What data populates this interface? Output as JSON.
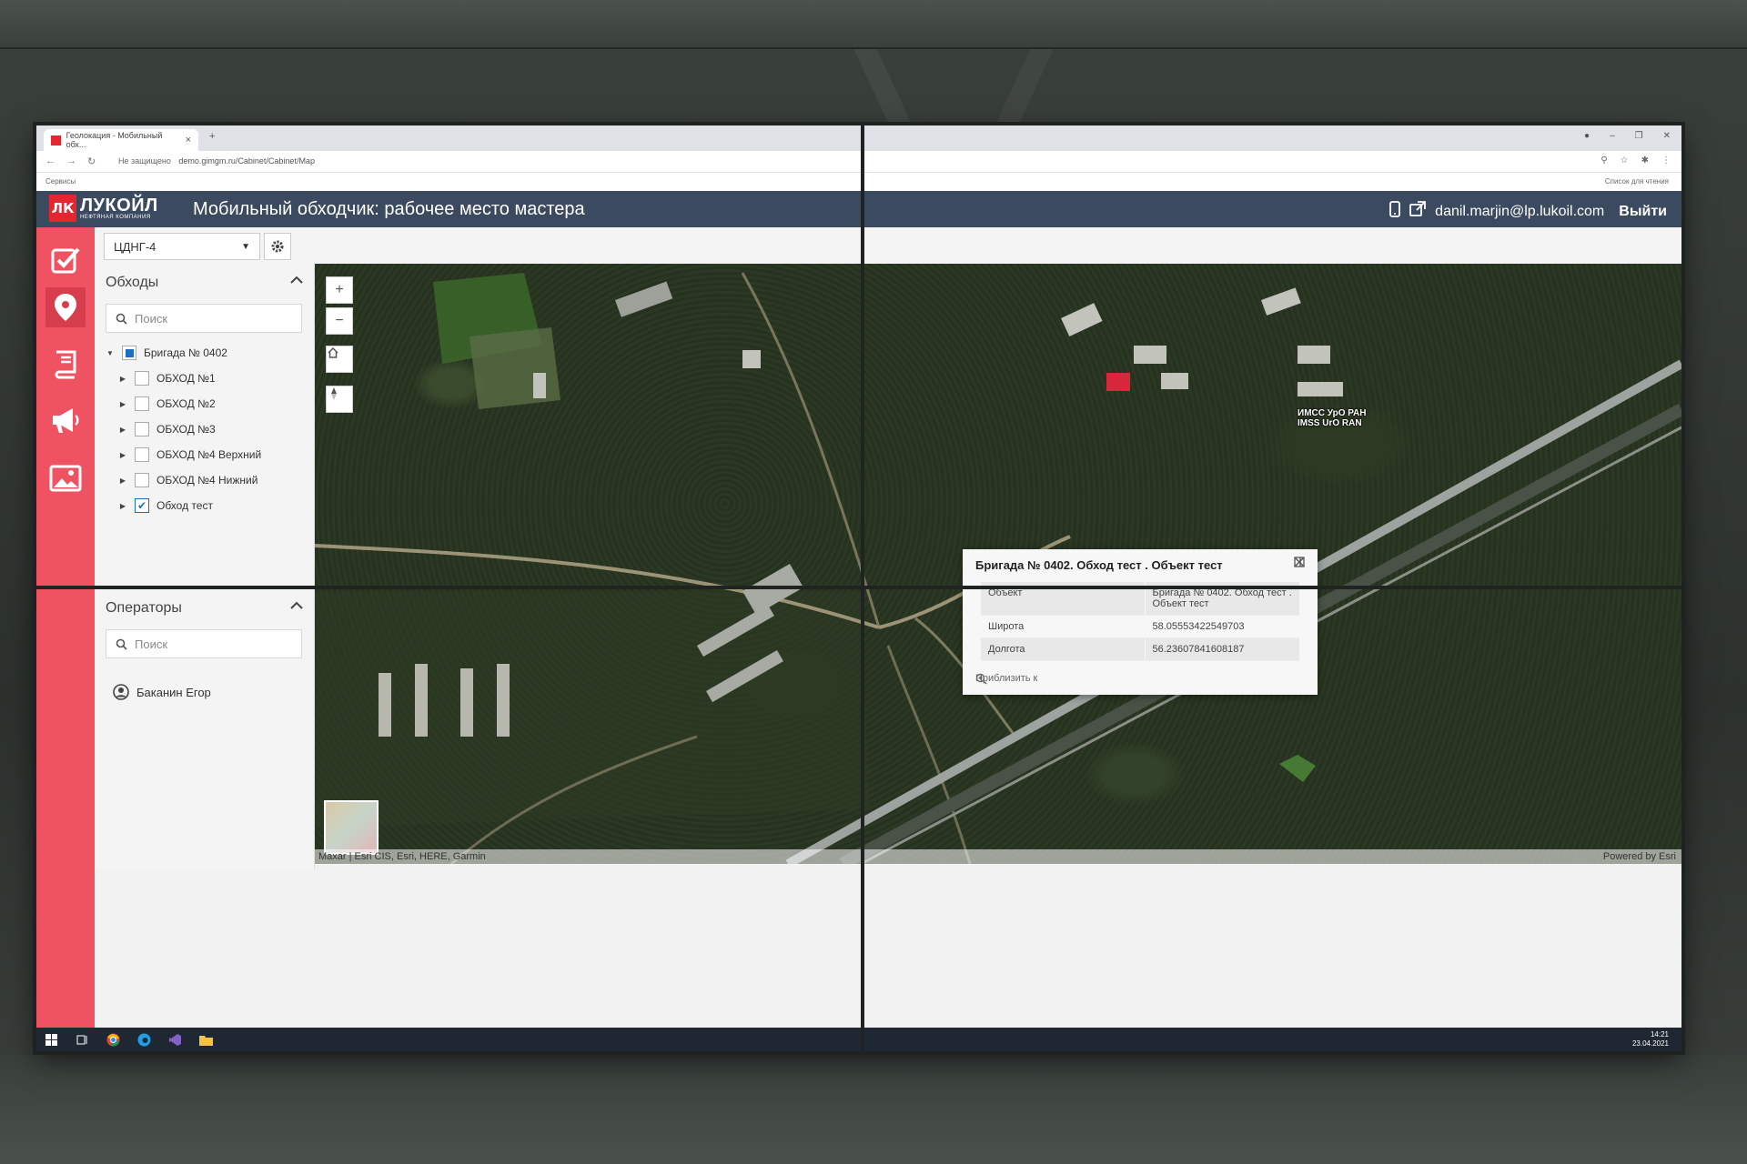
{
  "browser": {
    "tab_title": "Геолокация - Мобильный обх...",
    "tab_close": "×",
    "new_tab": "+",
    "url_security": "Не защищено",
    "url": "demo.gimgm.ru/Cabinet/Cabinet/Map",
    "bookmarks_label": "Сервисы",
    "reading_list": "Список для чтения"
  },
  "header": {
    "logo_mark": "ЛК",
    "logo_name": "ЛУКОЙЛ",
    "logo_sub": "НЕФТЯНАЯ КОМПАНИЯ",
    "title": "Мобильный обходчик: рабочее место мастера",
    "user_email": "danil.marjin@lp.lukoil.com",
    "logout_label": "Выйти"
  },
  "toolbar": {
    "department": "ЦДНГ-4"
  },
  "walks_panel": {
    "title": "Обходы",
    "search_placeholder": "Поиск",
    "brigade": "Бригада № 0402",
    "items": [
      {
        "label": "ОБХОД №1",
        "checked": false
      },
      {
        "label": "ОБХОД №2",
        "checked": false
      },
      {
        "label": "ОБХОД №3",
        "checked": false
      },
      {
        "label": "ОБХОД №4 Верхний",
        "checked": false
      },
      {
        "label": "ОБХОД №4 Нижний",
        "checked": false
      },
      {
        "label": "Обход тест",
        "checked": true
      }
    ]
  },
  "operators_panel": {
    "title": "Операторы",
    "search_placeholder": "Поиск",
    "operators": [
      "Баканин Егор"
    ]
  },
  "map": {
    "place_label_line1": "ИМСС УрО РАН",
    "place_label_line2": "IMSS UrO RAN",
    "attribution_left": "Maxar | Esri CIS, Esri, HERE, Garmin",
    "attribution_right": "Powered by Esri"
  },
  "popup": {
    "title": "Бригада № 0402. Обход тест . Объект тест",
    "rows": [
      {
        "key": "Объект",
        "value": "Бригада № 0402. Обход тест . Объект тест"
      },
      {
        "key": "Широта",
        "value": "58.05553422549703"
      },
      {
        "key": "Долгота",
        "value": "56.23607841608187"
      }
    ],
    "zoom_to_label": "Приблизить к"
  },
  "taskbar": {
    "time": "14:21",
    "date": "23.04.2021"
  }
}
